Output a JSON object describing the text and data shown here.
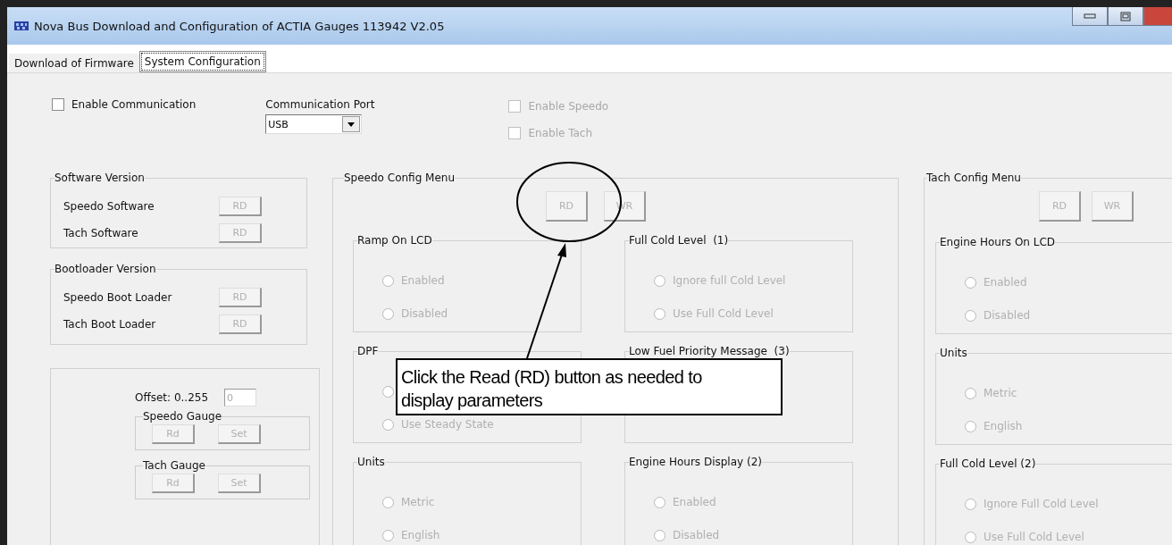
{
  "window": {
    "title": "Nova Bus Download and Configuration of ACTIA Gauges 113942 V2.05"
  },
  "tabs": [
    {
      "label": "Download of Firmware",
      "selected": false
    },
    {
      "label": "System Configuration",
      "selected": true
    }
  ],
  "enable_communication": {
    "label": "Enable Communication",
    "checked": false,
    "disabled": false
  },
  "communication_port": {
    "label": "Communication Port",
    "value": "USB"
  },
  "enable_checks": [
    {
      "label": "Enable Speedo",
      "checked": false,
      "disabled": true
    },
    {
      "label": "Enable Tach",
      "checked": false,
      "disabled": true
    }
  ],
  "software_version": {
    "title": "Software Version",
    "rows": [
      {
        "label": "Speedo Software",
        "button": "RD"
      },
      {
        "label": "Tach Software",
        "button": "RD"
      }
    ]
  },
  "bootloader_version": {
    "title": "Bootloader Version",
    "rows": [
      {
        "label": "Speedo Boot Loader",
        "button": "RD"
      },
      {
        "label": "Tach Boot Loader",
        "button": "RD"
      }
    ]
  },
  "offset": {
    "label": "Offset: 0..255",
    "value": "0",
    "gauges": [
      {
        "title": "Speedo Gauge",
        "buttons": [
          "Rd",
          "Set"
        ]
      },
      {
        "title": "Tach Gauge",
        "buttons": [
          "Rd",
          "Set"
        ]
      }
    ]
  },
  "speedo_config": {
    "title": "Speedo Config Menu",
    "buttons": [
      {
        "label": "RD",
        "disabled": true
      },
      {
        "label": "WR",
        "disabled": true
      }
    ],
    "columns": [
      [
        {
          "title": "Ramp On LCD",
          "options": [
            {
              "label": "Enabled",
              "selected": false,
              "disabled": true
            },
            {
              "label": "Disabled",
              "selected": false,
              "disabled": true
            }
          ]
        },
        {
          "title": "DPF",
          "options": [
            {
              "selected": false,
              "disabled": true
            },
            {
              "label": "Use Steady State",
              "selected": false,
              "disabled": true
            }
          ]
        },
        {
          "title": "Units",
          "options": [
            {
              "label": "Metric",
              "selected": false,
              "disabled": true
            },
            {
              "label": "English",
              "selected": false,
              "disabled": true
            }
          ]
        }
      ],
      [
        {
          "title": "Full Cold Level  (1)",
          "options": [
            {
              "label": "Ignore full Cold Level",
              "selected": false,
              "disabled": true
            },
            {
              "label": "Use Full Cold Level",
              "selected": false,
              "disabled": true
            }
          ]
        },
        {
          "title": "Low Fuel Priority Message  (3)"
        },
        {
          "title": "Engine Hours Display (2)",
          "options": [
            {
              "label": "Enabled",
              "selected": false,
              "disabled": true
            },
            {
              "label": "Disabled",
              "selected": false,
              "disabled": true
            }
          ]
        }
      ]
    ]
  },
  "tach_config": {
    "title": "Tach Config Menu",
    "buttons": [
      {
        "label": "RD",
        "disabled": true
      },
      {
        "label": "WR",
        "disabled": true
      }
    ],
    "groups": [
      {
        "title": "Engine Hours On LCD",
        "options": [
          {
            "label": "Enabled",
            "selected": false,
            "disabled": true
          },
          {
            "label": "Disabled",
            "selected": false,
            "disabled": true
          }
        ]
      },
      {
        "title": "Units",
        "options": [
          {
            "label": "Metric",
            "selected": false,
            "disabled": true
          },
          {
            "label": "English",
            "selected": false,
            "disabled": true
          }
        ]
      },
      {
        "title": "Full Cold Level (2)",
        "options": [
          {
            "label": "Ignore Full Cold Level",
            "selected": false,
            "disabled": true
          },
          {
            "label": "Use Full Cold Level",
            "selected": false,
            "disabled": true
          }
        ]
      }
    ]
  },
  "callout": {
    "text": "Click the Read (RD) button as needed to display parameters"
  }
}
